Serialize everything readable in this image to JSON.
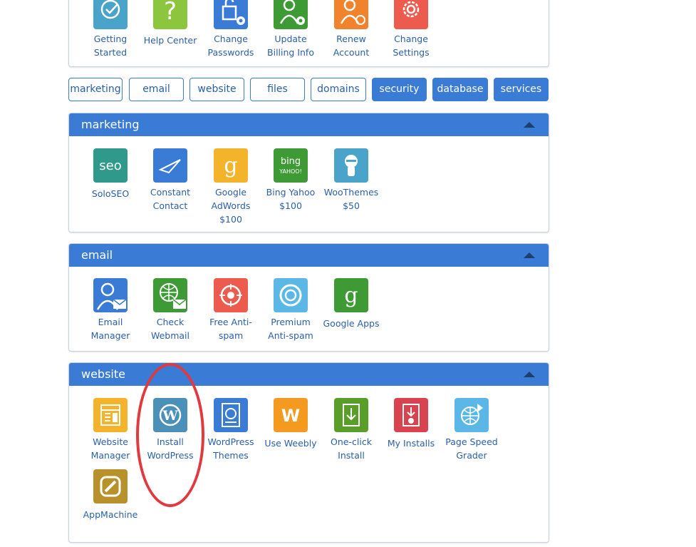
{
  "top_panel": {
    "items": [
      {
        "label_1": "Getting",
        "label_2": "Started",
        "icon": "checkmark-icon",
        "color": "#4aa3c9"
      },
      {
        "label_1": "Help Center",
        "label_2": "",
        "icon": "question-icon",
        "color": "#8cc63f"
      },
      {
        "label_1": "Change",
        "label_2": "Passwords",
        "icon": "lock-gear-icon",
        "color": "#3a7bd5"
      },
      {
        "label_1": "Update",
        "label_2": "Billing Info",
        "icon": "user-gear-icon",
        "color": "#3d9a35"
      },
      {
        "label_1": "Renew",
        "label_2": "Account",
        "icon": "user-refresh-icon",
        "color": "#f1832d"
      },
      {
        "label_1": "Change",
        "label_2": "Settings",
        "icon": "gear-icon",
        "color": "#ec5b4d"
      }
    ]
  },
  "tabs": [
    {
      "label": "marketing",
      "style": "outline"
    },
    {
      "label": "email",
      "style": "outline"
    },
    {
      "label": "website",
      "style": "outline"
    },
    {
      "label": "files",
      "style": "outline"
    },
    {
      "label": "domains",
      "style": "outline"
    },
    {
      "label": "security",
      "style": "filled"
    },
    {
      "label": "database",
      "style": "filled"
    },
    {
      "label": "services",
      "style": "filled"
    }
  ],
  "marketing": {
    "title": "marketing",
    "items": [
      {
        "label_1": "SoloSEO",
        "label_2": "",
        "label_3": "",
        "icon_text": "seo",
        "icon": "seo-icon",
        "color": "#2f9a8c"
      },
      {
        "label_1": "Constant",
        "label_2": "Contact",
        "label_3": "",
        "icon": "paper-plane-icon",
        "color": "#3a7bd5"
      },
      {
        "label_1": "Google",
        "label_2": "AdWords",
        "label_3": "$100",
        "icon_text": "g",
        "icon": "google-adwords-icon",
        "color": "#f3b42c"
      },
      {
        "label_1": "Bing Yahoo",
        "label_2": "$100",
        "label_3": "",
        "icon_text_1": "bing",
        "icon_text_2": "YAHOO!",
        "icon": "bing-yahoo-icon",
        "color": "#3d9a35"
      },
      {
        "label_1": "WooThemes",
        "label_2": "$50",
        "label_3": "",
        "icon": "ninja-icon",
        "color": "#4aa3c9"
      }
    ]
  },
  "email": {
    "title": "email",
    "items": [
      {
        "label_1": "Email",
        "label_2": "Manager",
        "icon": "user-mail-icon",
        "color": "#3a7bd5"
      },
      {
        "label_1": "Check",
        "label_2": "Webmail",
        "icon": "globe-mail-icon",
        "color": "#3d9a35"
      },
      {
        "label_1": "Free Anti-",
        "label_2": "spam",
        "icon": "target-icon",
        "color": "#ec5b4d"
      },
      {
        "label_1": "Premium",
        "label_2": "Anti-spam",
        "icon": "shield-ring-icon",
        "color": "#5bb8e6"
      },
      {
        "label_1": "Google Apps",
        "label_2": "",
        "icon_text": "g",
        "icon": "google-apps-icon",
        "color": "#3d9a35"
      }
    ]
  },
  "website": {
    "title": "website",
    "items": [
      {
        "label_1": "Website",
        "label_2": "Manager",
        "icon": "layout-icon",
        "color": "#f3b42c"
      },
      {
        "label_1": "Install",
        "label_2": "WordPress",
        "icon": "wordpress-icon",
        "color": "#4a90b8"
      },
      {
        "label_1": "WordPress",
        "label_2": "Themes",
        "icon": "wordpress-doc-icon",
        "color": "#3a7bd5"
      },
      {
        "label_1": "Use Weebly",
        "label_2": "",
        "icon_text": "W",
        "icon": "weebly-icon",
        "color": "#f39a1f"
      },
      {
        "label_1": "One-click",
        "label_2": "Install",
        "icon": "install-icon",
        "color": "#5a9e2a"
      },
      {
        "label_1": "My Installs",
        "label_2": "",
        "icon": "installs-icon",
        "color": "#d9424f"
      },
      {
        "label_1": "Page Speed",
        "label_2": "Grader",
        "icon": "globe-arrow-icon",
        "color": "#5bb8e6"
      },
      {
        "label_1": "AppMachine",
        "label_2": "",
        "icon": "appmachine-icon",
        "color": "#b8912b"
      }
    ]
  },
  "annotation": {
    "color": "#e0393e",
    "target": "Install WordPress"
  }
}
